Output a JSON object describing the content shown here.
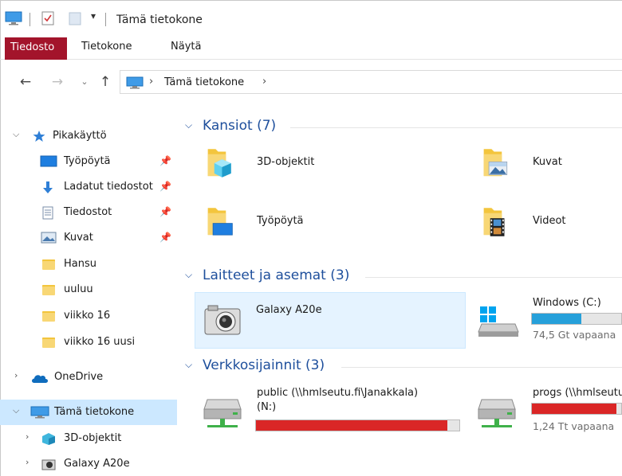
{
  "window": {
    "title": "Tämä tietokone"
  },
  "ribbon": {
    "tabs": [
      {
        "label": "Tiedosto",
        "active": true
      },
      {
        "label": "Tietokone"
      },
      {
        "label": "Näytä"
      }
    ]
  },
  "address": {
    "path": "Tämä tietokone",
    "buttons": [
      "back-arrow-icon",
      "forward-arrow-icon",
      "recent-chevron-icon",
      "up-arrow-icon"
    ]
  },
  "nav": {
    "quick_access": "Pikakäyttö",
    "quick_items": [
      {
        "label": "Työpöytä",
        "icon": "desktop-icon",
        "pinned": true
      },
      {
        "label": "Ladatut tiedostot",
        "icon": "download-icon",
        "pinned": true
      },
      {
        "label": "Tiedostot",
        "icon": "document-icon",
        "pinned": true
      },
      {
        "label": "Kuvat",
        "icon": "pictures-icon",
        "pinned": true
      },
      {
        "label": "Hansu",
        "icon": "folder-icon"
      },
      {
        "label": "uuluu",
        "icon": "folder-icon"
      },
      {
        "label": "viikko 16",
        "icon": "folder-icon"
      },
      {
        "label": "viikko 16 uusi",
        "icon": "folder-icon"
      }
    ],
    "onedrive": "OneDrive",
    "this_pc": "Tämä tietokone",
    "this_pc_children": [
      {
        "label": "3D-objektit",
        "icon": "3d-objects-icon"
      },
      {
        "label": "Galaxy A20e",
        "icon": "camera-icon"
      }
    ]
  },
  "groups": {
    "folders": {
      "title": "Kansiot (7)",
      "items": [
        {
          "label": "3D-objektit"
        },
        {
          "label": "Kuvat"
        },
        {
          "label": "Työpöytä"
        },
        {
          "label": "Videot"
        }
      ]
    },
    "devices": {
      "title": "Laitteet ja asemat (3)",
      "items": [
        {
          "label": "Galaxy A20e"
        },
        {
          "label": "Windows (C:)",
          "free": "74,5 Gt vapaana",
          "used_fraction": 0.55,
          "bar_color": "#26a0da"
        }
      ]
    },
    "network": {
      "title": "Verkkosijainnit (3)",
      "items": [
        {
          "label_line1": "public (\\\\hmlseutu.fi\\Janakkala)",
          "label_line2": "(N:)",
          "used_fraction": 0.94,
          "bar_color": "#da2626"
        },
        {
          "label": "progs (\\\\hmlseutu.fi",
          "free": "1,24 Tt vapaana",
          "used_fraction": 0.95,
          "bar_color": "#da2626"
        }
      ]
    }
  }
}
